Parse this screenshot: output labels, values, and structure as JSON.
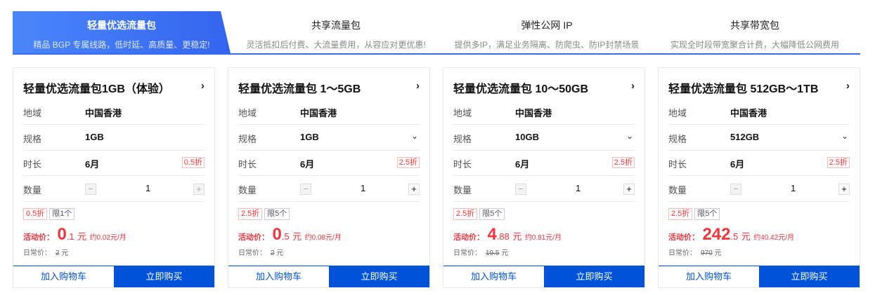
{
  "tabs": [
    {
      "title": "轻量优选流量包",
      "sub": "精品 BGP 专属线路，低时延、高质量、更稳定!"
    },
    {
      "title": "共享流量包",
      "sub": "灵活抵扣后付费、大流量费用，从容应对更优惠!"
    },
    {
      "title": "弹性公网 IP",
      "sub": "提供多IP，满足业务隔离、防爬虫、防IP封禁场景"
    },
    {
      "title": "共享带宽包",
      "sub": "实现全时段带宽聚合计费，大幅降低公网费用"
    }
  ],
  "labels": {
    "region": "地域",
    "spec": "规格",
    "duration": "时长",
    "quantity": "数量",
    "promo": "活动价：",
    "regular": "日常价：",
    "add_cart": "加入购物车",
    "buy_now": "立即购买",
    "arrow": "›",
    "dropdown": "⌄",
    "minus": "−",
    "plus": "+",
    "yuan": "元"
  },
  "cards": [
    {
      "title": "轻量优选流量包1GB（体验）",
      "region": "中国香港",
      "spec": "1GB",
      "duration": "6月",
      "discount": "0.5折",
      "limit": "限1个",
      "qty": "1",
      "price_int": "0",
      "price_dec": ".1",
      "monthly": "约0.02元/月",
      "orig": "2"
    },
    {
      "title": "轻量优选流量包 1～5GB",
      "region": "中国香港",
      "spec": "1GB",
      "duration": "6月",
      "discount": "2.5折",
      "limit": "限5个",
      "qty": "1",
      "price_int": "0",
      "price_dec": ".5",
      "monthly": "约0.08元/月",
      "orig": "2"
    },
    {
      "title": "轻量优选流量包 10～50GB",
      "region": "中国香港",
      "spec": "10GB",
      "duration": "6月",
      "discount": "2.5折",
      "limit": "限5个",
      "qty": "1",
      "price_int": "4",
      "price_dec": ".88",
      "monthly": "约0.81元/月",
      "orig": "19.5"
    },
    {
      "title": "轻量优选流量包 512GB～1TB",
      "region": "中国香港",
      "spec": "512GB",
      "duration": "6月",
      "discount": "2.5折",
      "limit": "限5个",
      "qty": "1",
      "price_int": "242",
      "price_dec": ".5",
      "monthly": "约40.42元/月",
      "orig": "970"
    }
  ]
}
